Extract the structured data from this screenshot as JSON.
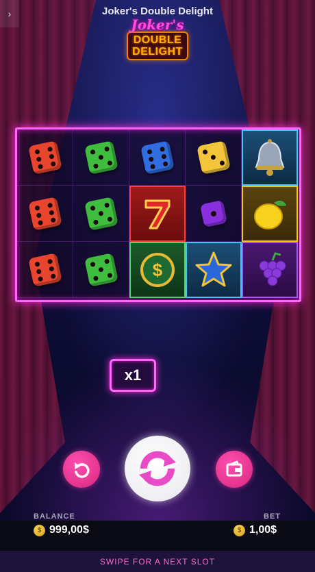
{
  "header": {
    "title": "Joker's Double Delight",
    "back_icon": "chevron-right-icon",
    "logo": {
      "script": "Joker's",
      "line1": "DOUBLE",
      "line2": "DELIGHT"
    }
  },
  "grid": {
    "rows": [
      [
        "red-die-6",
        "green-die-5",
        "blue-die-6",
        "yellow-die-3",
        "bell"
      ],
      [
        "red-die-6",
        "green-die-5",
        "seven",
        "purple-die-1",
        "lemon"
      ],
      [
        "red-die-6",
        "green-die-5",
        "dollar-coin",
        "star",
        "grapes"
      ]
    ]
  },
  "multiplier": {
    "label": "x1"
  },
  "controls": {
    "left_icon": "undo-icon",
    "spin_icon": "refresh-icon",
    "right_icon": "wallet-icon"
  },
  "balance": {
    "label": "BALANCE",
    "value": "999,00$"
  },
  "bet": {
    "label": "BET",
    "value": "1,00$"
  },
  "footer": {
    "swipe_text": "SWIPE FOR A NEXT SLOT"
  },
  "colors": {
    "neon_pink": "#ff66ff",
    "accent": "#ff4fb0"
  }
}
